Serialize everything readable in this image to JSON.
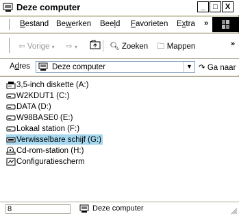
{
  "window": {
    "title": "Deze computer",
    "minimize": "_",
    "maximize": "□",
    "close": "X"
  },
  "menu": {
    "items": [
      {
        "pre": "",
        "accel": "B",
        "post": "estand"
      },
      {
        "pre": "Be",
        "accel": "w",
        "post": "erken"
      },
      {
        "pre": "Bee",
        "accel": "l",
        "post": "d"
      },
      {
        "pre": "",
        "accel": "F",
        "post": "avorieten"
      },
      {
        "pre": "E",
        "accel": "x",
        "post": "tra"
      }
    ],
    "overflow": "»"
  },
  "toolbar": {
    "back": "Vorige",
    "search": "Zoeken",
    "folders": "Mappen",
    "overflow": "»"
  },
  "address": {
    "label_pre": "A",
    "label_accel": "d",
    "label_post": "res",
    "value": "Deze computer",
    "go": "Ga naar"
  },
  "items": [
    {
      "label": "3,5-inch diskette (A:)",
      "icon": "floppy-drive-icon"
    },
    {
      "label": "W2KDUT1 (C:)",
      "icon": "hard-drive-icon"
    },
    {
      "label": "DATA (D:)",
      "icon": "hard-drive-icon"
    },
    {
      "label": "W98BASE0 (E:)",
      "icon": "hard-drive-icon"
    },
    {
      "label": "Lokaal station (F:)",
      "icon": "hard-drive-icon"
    },
    {
      "label": "Verwisselbare schijf (G:)",
      "icon": "removable-drive-icon",
      "selected": true
    },
    {
      "label": "Cd-rom-station (H:)",
      "icon": "cd-drive-icon"
    },
    {
      "label": "Configuratiescherm",
      "icon": "control-panel-icon"
    }
  ],
  "status": {
    "count": "8",
    "location": "Deze computer"
  }
}
